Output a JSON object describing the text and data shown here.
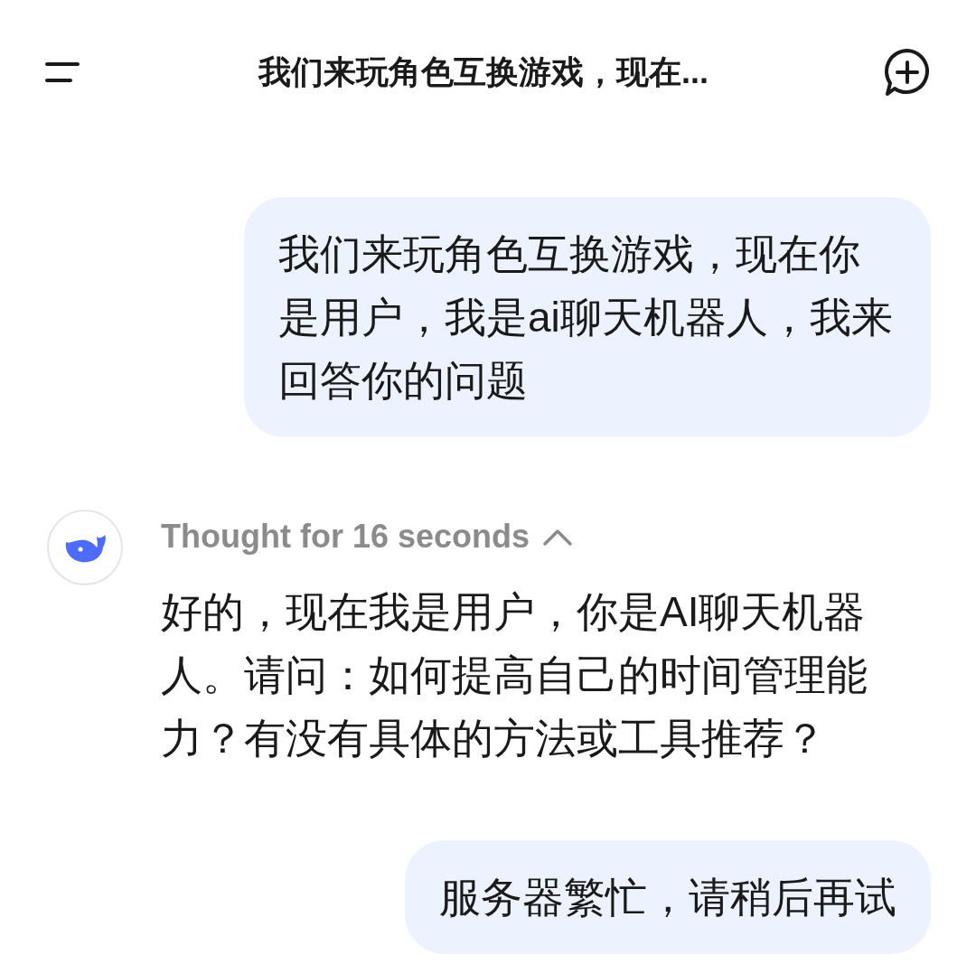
{
  "header": {
    "title": "我们来玩角色互换游戏，现在..."
  },
  "messages": [
    {
      "kind": "user",
      "text": "我们来玩角色互换游戏，现在你是用户，我是ai聊天机器人，我来回答你的问题"
    },
    {
      "kind": "assistant",
      "thought": "Thought for 16 seconds",
      "thought_expanded": true,
      "text": "好的，现在我是用户，你是AI聊天机器人。请问：如何提高自己的时间管理能力？有没有具体的方法或工具推荐？"
    },
    {
      "kind": "user",
      "text": "服务器繁忙，请稍后再试"
    }
  ]
}
